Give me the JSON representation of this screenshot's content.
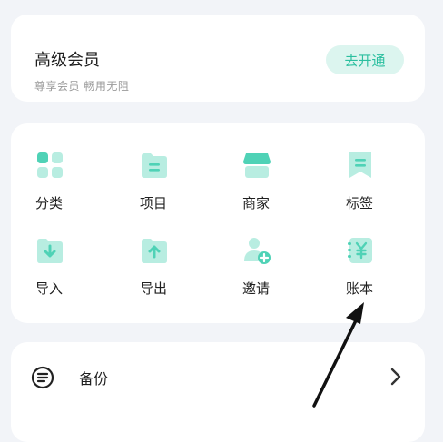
{
  "colors": {
    "accent": "#4fd2b6",
    "accent_light": "#b8ede1",
    "background": "#f2f4f8",
    "card": "#ffffff"
  },
  "vip": {
    "title": "高级会员",
    "subtitle": "尊享会员 畅用无阻",
    "button": "去开通"
  },
  "grid": {
    "items": [
      {
        "label": "分类",
        "icon": "category-icon"
      },
      {
        "label": "项目",
        "icon": "folder-icon"
      },
      {
        "label": "商家",
        "icon": "store-icon"
      },
      {
        "label": "标签",
        "icon": "tag-icon"
      },
      {
        "label": "导入",
        "icon": "import-icon"
      },
      {
        "label": "导出",
        "icon": "export-icon"
      },
      {
        "label": "邀请",
        "icon": "invite-user-icon"
      },
      {
        "label": "账本",
        "icon": "ledger-icon"
      }
    ]
  },
  "backup": {
    "label": "备份",
    "icon": "backup-menu-icon"
  }
}
